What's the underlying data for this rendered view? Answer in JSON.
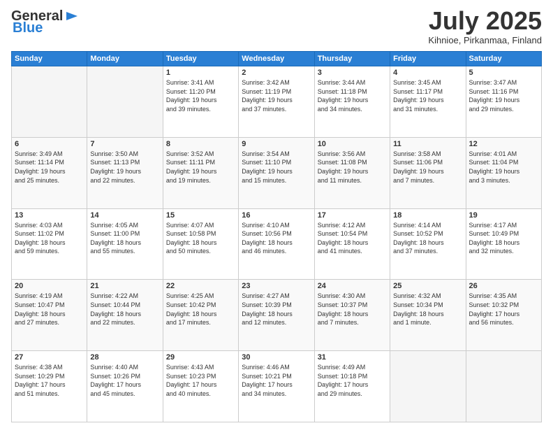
{
  "header": {
    "logo_general": "General",
    "logo_blue": "Blue",
    "month_title": "July 2025",
    "location": "Kihnioe, Pirkanmaa, Finland"
  },
  "days_of_week": [
    "Sunday",
    "Monday",
    "Tuesday",
    "Wednesday",
    "Thursday",
    "Friday",
    "Saturday"
  ],
  "weeks": [
    [
      {
        "day": "",
        "detail": ""
      },
      {
        "day": "",
        "detail": ""
      },
      {
        "day": "1",
        "detail": "Sunrise: 3:41 AM\nSunset: 11:20 PM\nDaylight: 19 hours\nand 39 minutes."
      },
      {
        "day": "2",
        "detail": "Sunrise: 3:42 AM\nSunset: 11:19 PM\nDaylight: 19 hours\nand 37 minutes."
      },
      {
        "day": "3",
        "detail": "Sunrise: 3:44 AM\nSunset: 11:18 PM\nDaylight: 19 hours\nand 34 minutes."
      },
      {
        "day": "4",
        "detail": "Sunrise: 3:45 AM\nSunset: 11:17 PM\nDaylight: 19 hours\nand 31 minutes."
      },
      {
        "day": "5",
        "detail": "Sunrise: 3:47 AM\nSunset: 11:16 PM\nDaylight: 19 hours\nand 29 minutes."
      }
    ],
    [
      {
        "day": "6",
        "detail": "Sunrise: 3:49 AM\nSunset: 11:14 PM\nDaylight: 19 hours\nand 25 minutes."
      },
      {
        "day": "7",
        "detail": "Sunrise: 3:50 AM\nSunset: 11:13 PM\nDaylight: 19 hours\nand 22 minutes."
      },
      {
        "day": "8",
        "detail": "Sunrise: 3:52 AM\nSunset: 11:11 PM\nDaylight: 19 hours\nand 19 minutes."
      },
      {
        "day": "9",
        "detail": "Sunrise: 3:54 AM\nSunset: 11:10 PM\nDaylight: 19 hours\nand 15 minutes."
      },
      {
        "day": "10",
        "detail": "Sunrise: 3:56 AM\nSunset: 11:08 PM\nDaylight: 19 hours\nand 11 minutes."
      },
      {
        "day": "11",
        "detail": "Sunrise: 3:58 AM\nSunset: 11:06 PM\nDaylight: 19 hours\nand 7 minutes."
      },
      {
        "day": "12",
        "detail": "Sunrise: 4:01 AM\nSunset: 11:04 PM\nDaylight: 19 hours\nand 3 minutes."
      }
    ],
    [
      {
        "day": "13",
        "detail": "Sunrise: 4:03 AM\nSunset: 11:02 PM\nDaylight: 18 hours\nand 59 minutes."
      },
      {
        "day": "14",
        "detail": "Sunrise: 4:05 AM\nSunset: 11:00 PM\nDaylight: 18 hours\nand 55 minutes."
      },
      {
        "day": "15",
        "detail": "Sunrise: 4:07 AM\nSunset: 10:58 PM\nDaylight: 18 hours\nand 50 minutes."
      },
      {
        "day": "16",
        "detail": "Sunrise: 4:10 AM\nSunset: 10:56 PM\nDaylight: 18 hours\nand 46 minutes."
      },
      {
        "day": "17",
        "detail": "Sunrise: 4:12 AM\nSunset: 10:54 PM\nDaylight: 18 hours\nand 41 minutes."
      },
      {
        "day": "18",
        "detail": "Sunrise: 4:14 AM\nSunset: 10:52 PM\nDaylight: 18 hours\nand 37 minutes."
      },
      {
        "day": "19",
        "detail": "Sunrise: 4:17 AM\nSunset: 10:49 PM\nDaylight: 18 hours\nand 32 minutes."
      }
    ],
    [
      {
        "day": "20",
        "detail": "Sunrise: 4:19 AM\nSunset: 10:47 PM\nDaylight: 18 hours\nand 27 minutes."
      },
      {
        "day": "21",
        "detail": "Sunrise: 4:22 AM\nSunset: 10:44 PM\nDaylight: 18 hours\nand 22 minutes."
      },
      {
        "day": "22",
        "detail": "Sunrise: 4:25 AM\nSunset: 10:42 PM\nDaylight: 18 hours\nand 17 minutes."
      },
      {
        "day": "23",
        "detail": "Sunrise: 4:27 AM\nSunset: 10:39 PM\nDaylight: 18 hours\nand 12 minutes."
      },
      {
        "day": "24",
        "detail": "Sunrise: 4:30 AM\nSunset: 10:37 PM\nDaylight: 18 hours\nand 7 minutes."
      },
      {
        "day": "25",
        "detail": "Sunrise: 4:32 AM\nSunset: 10:34 PM\nDaylight: 18 hours\nand 1 minute."
      },
      {
        "day": "26",
        "detail": "Sunrise: 4:35 AM\nSunset: 10:32 PM\nDaylight: 17 hours\nand 56 minutes."
      }
    ],
    [
      {
        "day": "27",
        "detail": "Sunrise: 4:38 AM\nSunset: 10:29 PM\nDaylight: 17 hours\nand 51 minutes."
      },
      {
        "day": "28",
        "detail": "Sunrise: 4:40 AM\nSunset: 10:26 PM\nDaylight: 17 hours\nand 45 minutes."
      },
      {
        "day": "29",
        "detail": "Sunrise: 4:43 AM\nSunset: 10:23 PM\nDaylight: 17 hours\nand 40 minutes."
      },
      {
        "day": "30",
        "detail": "Sunrise: 4:46 AM\nSunset: 10:21 PM\nDaylight: 17 hours\nand 34 minutes."
      },
      {
        "day": "31",
        "detail": "Sunrise: 4:49 AM\nSunset: 10:18 PM\nDaylight: 17 hours\nand 29 minutes."
      },
      {
        "day": "",
        "detail": ""
      },
      {
        "day": "",
        "detail": ""
      }
    ]
  ]
}
